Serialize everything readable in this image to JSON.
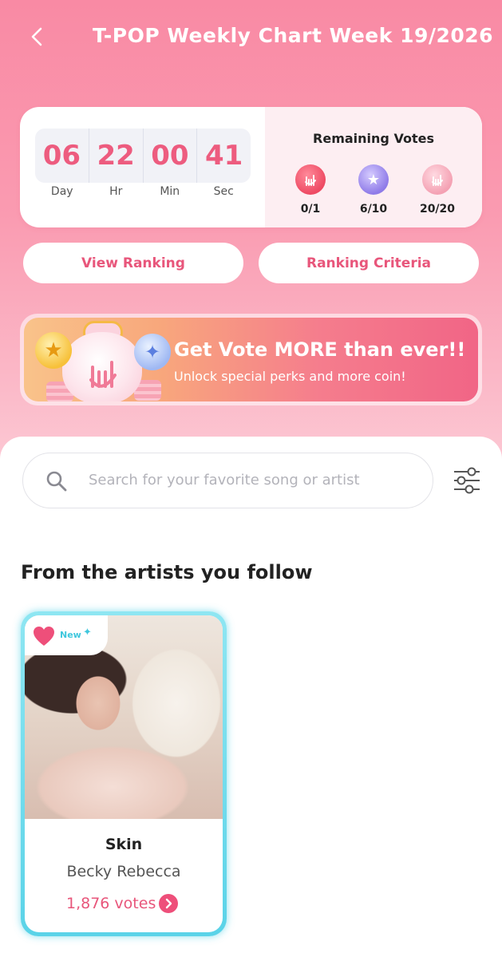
{
  "header": {
    "title": "T-POP Weekly Chart Week 19/2026"
  },
  "countdown": {
    "days": "06",
    "hours": "22",
    "minutes": "00",
    "seconds": "41",
    "labels": {
      "day": "Day",
      "hr": "Hr",
      "min": "Min",
      "sec": "Sec"
    }
  },
  "votes": {
    "title": "Remaining Votes",
    "items": [
      {
        "icon": "rock-hand-coin-icon",
        "count": "0/1",
        "color": "#f0566f"
      },
      {
        "icon": "star-coin-icon",
        "count": "6/10",
        "color": "#9a86ec"
      },
      {
        "icon": "pink-rock-hand-coin-icon",
        "count": "20/20",
        "color": "#f6a7b6"
      }
    ]
  },
  "buttons": {
    "view_ranking": "View Ranking",
    "ranking_criteria": "Ranking Criteria"
  },
  "banner": {
    "title": "Get Vote MORE than ever!!",
    "subtitle": "Unlock special perks and more coin!"
  },
  "search": {
    "placeholder": "Search for your favorite song or artist",
    "value": ""
  },
  "section": {
    "title": "From the artists you follow"
  },
  "songs": [
    {
      "tag": "New",
      "title": "Skin",
      "artist": "Becky Rebecca",
      "votes": "1,876 votes"
    }
  ],
  "colors": {
    "accent": "#e8567b",
    "timer": "#ed5c7f",
    "card_border": "#5ad3e8",
    "new_tag": "#3fc7dd"
  }
}
